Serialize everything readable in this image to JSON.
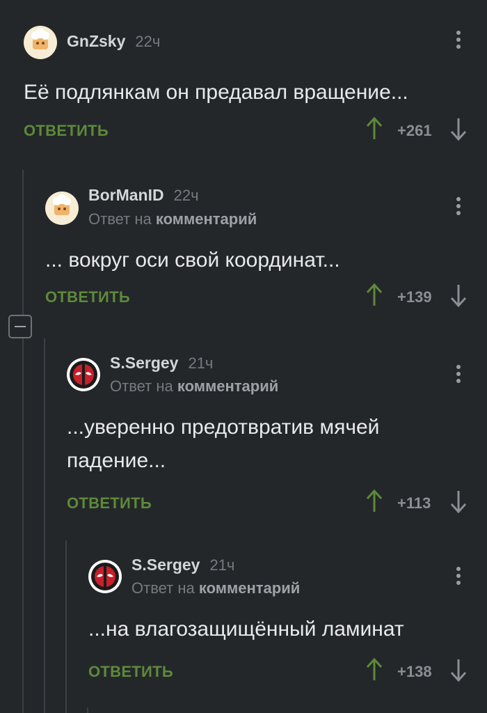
{
  "reply_label": "ОТВЕТИТЬ",
  "reply_to_prefix": "Ответ на",
  "reply_to_target": "комментарий",
  "comments": [
    {
      "author": "GnZsky",
      "time": "22ч",
      "text": "Её подлянкам он предавал вращение...",
      "score": "+261",
      "avatar": "chef-avatar",
      "reply": false
    },
    {
      "author": "BorManID",
      "time": "22ч",
      "text": "... вокруг оси свой координат...",
      "score": "+139",
      "avatar": "chef-avatar",
      "reply": true
    },
    {
      "author": "S.Sergey",
      "time": "21ч",
      "text": "...уверенно предотвратив мячей падение...",
      "score": "+113",
      "avatar": "deadpool-avatar",
      "reply": true
    },
    {
      "author": "S.Sergey",
      "time": "21ч",
      "text": "...на влагозащищённый ламинат",
      "score": "+138",
      "avatar": "deadpool-avatar",
      "reply": true
    }
  ],
  "colors": {
    "background": "#24272a",
    "reply_button": "#5d8a3a",
    "upvote_arrow": "#5d8a3a",
    "thread_line": "#3b4045"
  }
}
